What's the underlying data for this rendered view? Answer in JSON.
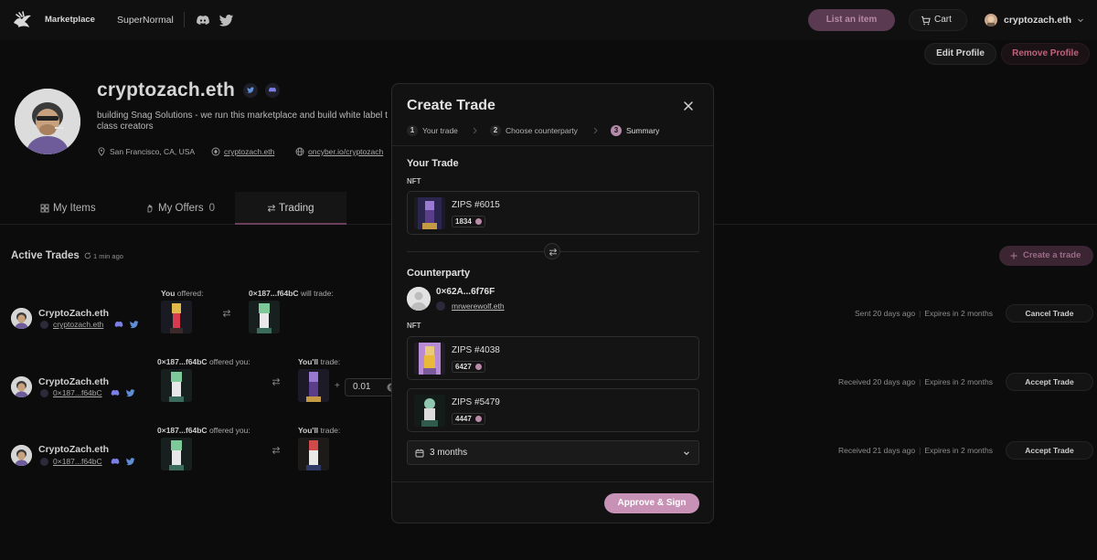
{
  "nav": {
    "marketplace": "Marketplace",
    "supernormal": "SuperNormal",
    "list_item": "List an item",
    "cart": "Cart",
    "account": "cryptozach.eth"
  },
  "profile": {
    "name": "cryptozach.eth",
    "bio_line1": "building Snag Solutions - we run this marketplace and build white label t",
    "bio_line2": "class creators",
    "location": "San Francisco, CA, USA",
    "ens": "cryptozach.eth",
    "website": "oncyber.io/cryptozach",
    "edit_label": "Edit Profile",
    "remove_label": "Remove Profile"
  },
  "tabs": {
    "items": "My Items",
    "offers": "My Offers",
    "offers_count": "0",
    "trading": "Trading"
  },
  "trades": {
    "title": "Active Trades",
    "refreshed": "1 min ago",
    "create_label": "Create a trade",
    "rows": [
      {
        "name": "CryptoZach.eth",
        "handle": "cryptozach.eth",
        "left_label_prefix": "You",
        "left_label_suffix": " offered:",
        "right_label_prefix": "0×187...f64bC",
        "right_label_suffix": " will trade:",
        "status_time": "Sent 20 days ago",
        "status_expiry": "Expires in 2 months",
        "button": "Cancel Trade"
      },
      {
        "name": "CryptoZach.eth",
        "handle": "0×187...f64bC",
        "left_label_prefix": "0×187...f64bC",
        "left_label_suffix": " offered you:",
        "right_label_prefix": "You'll",
        "right_label_suffix": " trade:",
        "eth_amount": "0.01",
        "status_time": "Received 20 days ago",
        "status_expiry": "Expires in 2 months",
        "button": "Accept Trade"
      },
      {
        "name": "CryptoZach.eth",
        "handle": "0×187...f64bC",
        "left_label_prefix": "0×187...f64bC",
        "left_label_suffix": " offered you:",
        "right_label_prefix": "You'll",
        "right_label_suffix": " trade:",
        "status_time": "Received 21 days ago",
        "status_expiry": "Expires in 2 months",
        "button": "Accept Trade"
      }
    ]
  },
  "modal": {
    "title": "Create Trade",
    "steps": [
      {
        "num": "1",
        "label": "Your trade"
      },
      {
        "num": "2",
        "label": "Choose counterparty"
      },
      {
        "num": "3",
        "label": "Summary"
      }
    ],
    "your_trade_title": "Your Trade",
    "nft_label": "NFT",
    "your_nft": {
      "name": "ZIPS #6015",
      "rank": "1834"
    },
    "counterparty_title": "Counterparty",
    "counterparty_address": "0×62A...6f76F",
    "counterparty_ens": "mrwerewolf.eth",
    "counterparty_nfts": [
      {
        "name": "ZIPS #4038",
        "rank": "6427"
      },
      {
        "name": "ZIPS #5479",
        "rank": "4447"
      }
    ],
    "duration": "3 months",
    "approve_label": "Approve & Sign"
  },
  "colors": {
    "accent": "#c792b6",
    "accent_dark": "#5a3a50",
    "danger": "#c0637e",
    "background": "#0c0c0c"
  },
  "icons": {
    "logo": "zips-logo-icon",
    "discord": "discord-icon",
    "twitter": "twitter-icon",
    "cart": "cart-icon",
    "close": "close-icon",
    "swap": "swap-icon",
    "calendar": "calendar-icon"
  }
}
